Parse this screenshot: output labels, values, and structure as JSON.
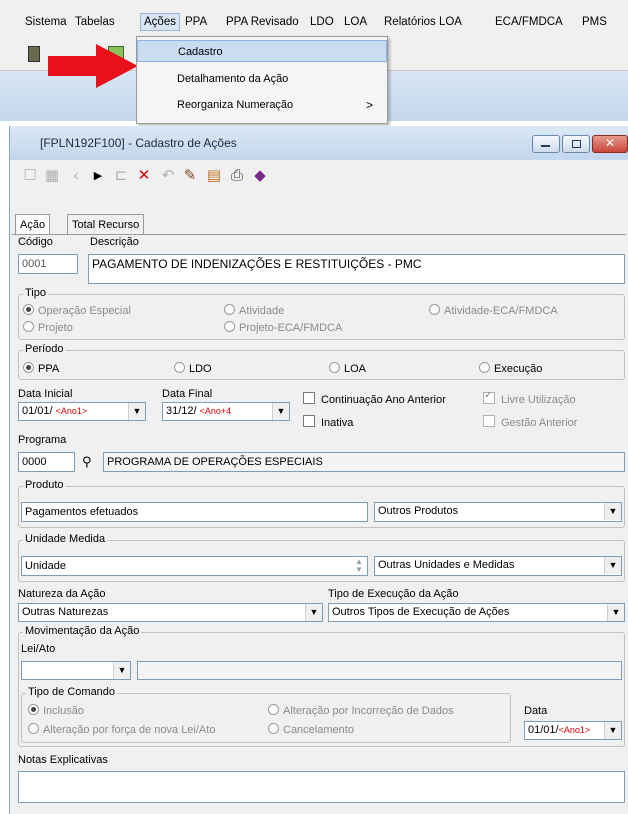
{
  "menubar": {
    "items": [
      "Sistema",
      "Tabelas",
      "Ações",
      "PPA",
      "PPA Revisado",
      "LDO",
      "LOA",
      "Relatórios LOA",
      "ECA/FMDCA",
      "PMS"
    ]
  },
  "dropdown": {
    "items": [
      "Cadastro",
      "Detalhamento da Ação",
      "Reorganiza Numeração"
    ],
    "submenu_arrow": ">"
  },
  "window": {
    "title": "[FPLN192F100] - Cadastro de Ações",
    "tabs": [
      "Ação",
      "Total Recurso"
    ]
  },
  "form": {
    "codigo_label": "Código",
    "descricao_label": "Descrição",
    "codigo": "0001",
    "descricao": "PAGAMENTO DE INDENIZAÇÕES E RESTITUIÇÕES - PMC",
    "tipo": {
      "title": "Tipo",
      "options": [
        "Operação Especial",
        "Atividade",
        "Atividade-ECA/FMDCA",
        "Projeto",
        "Projeto-ECA/FMDCA"
      ]
    },
    "periodo": {
      "title": "Período",
      "options": [
        "PPA",
        "LDO",
        "LOA",
        "Execução"
      ]
    },
    "data_inicial_label": "Data Inicial",
    "data_inicial": "01/01/",
    "data_inicial_tag": "<Ano1>",
    "data_final_label": "Data Final",
    "data_final": "31/12/",
    "data_final_tag": "<Ano+4",
    "continuacao": "Continuação Ano Anterior",
    "inativa": "Inativa",
    "livre": "Livre Utilização",
    "gestao": "Gestão Anterior",
    "programa_label": "Programa",
    "programa_codigo": "0000",
    "programa_nome": "PROGRAMA DE OPERAÇÕES ESPECIAIS",
    "produto": {
      "title": "Produto",
      "value": "Pagamentos efetuados",
      "tipo": "Outros Produtos"
    },
    "unidade": {
      "title": "Unidade Medida",
      "value": "Unidade",
      "tipo": "Outras Unidades e Medidas"
    },
    "natureza_label": "Natureza da Ação",
    "natureza": "Outras Naturezas",
    "tipo_exec_label": "Tipo de Execução da Ação",
    "tipo_exec": "Outros Tipos de Execução de Ações",
    "movimentacao": {
      "title": "Movimentação da Ação",
      "lei_label": "Lei/Ato"
    },
    "tipo_comando": {
      "title": "Tipo de Comando",
      "options": [
        "Inclusão",
        "Alteração por Incorreção de Dados",
        "Alteração por força de nova Lei/Ato",
        "Cancelamento"
      ]
    },
    "data_label": "Data",
    "data_value": "01/01/",
    "data_tag": "<Ano1>",
    "notas_label": "Notas Explicativas"
  },
  "colors": {
    "accent_red": "#e00000",
    "title_blue": "#c2d6ec",
    "close_red": "#c8463a"
  }
}
